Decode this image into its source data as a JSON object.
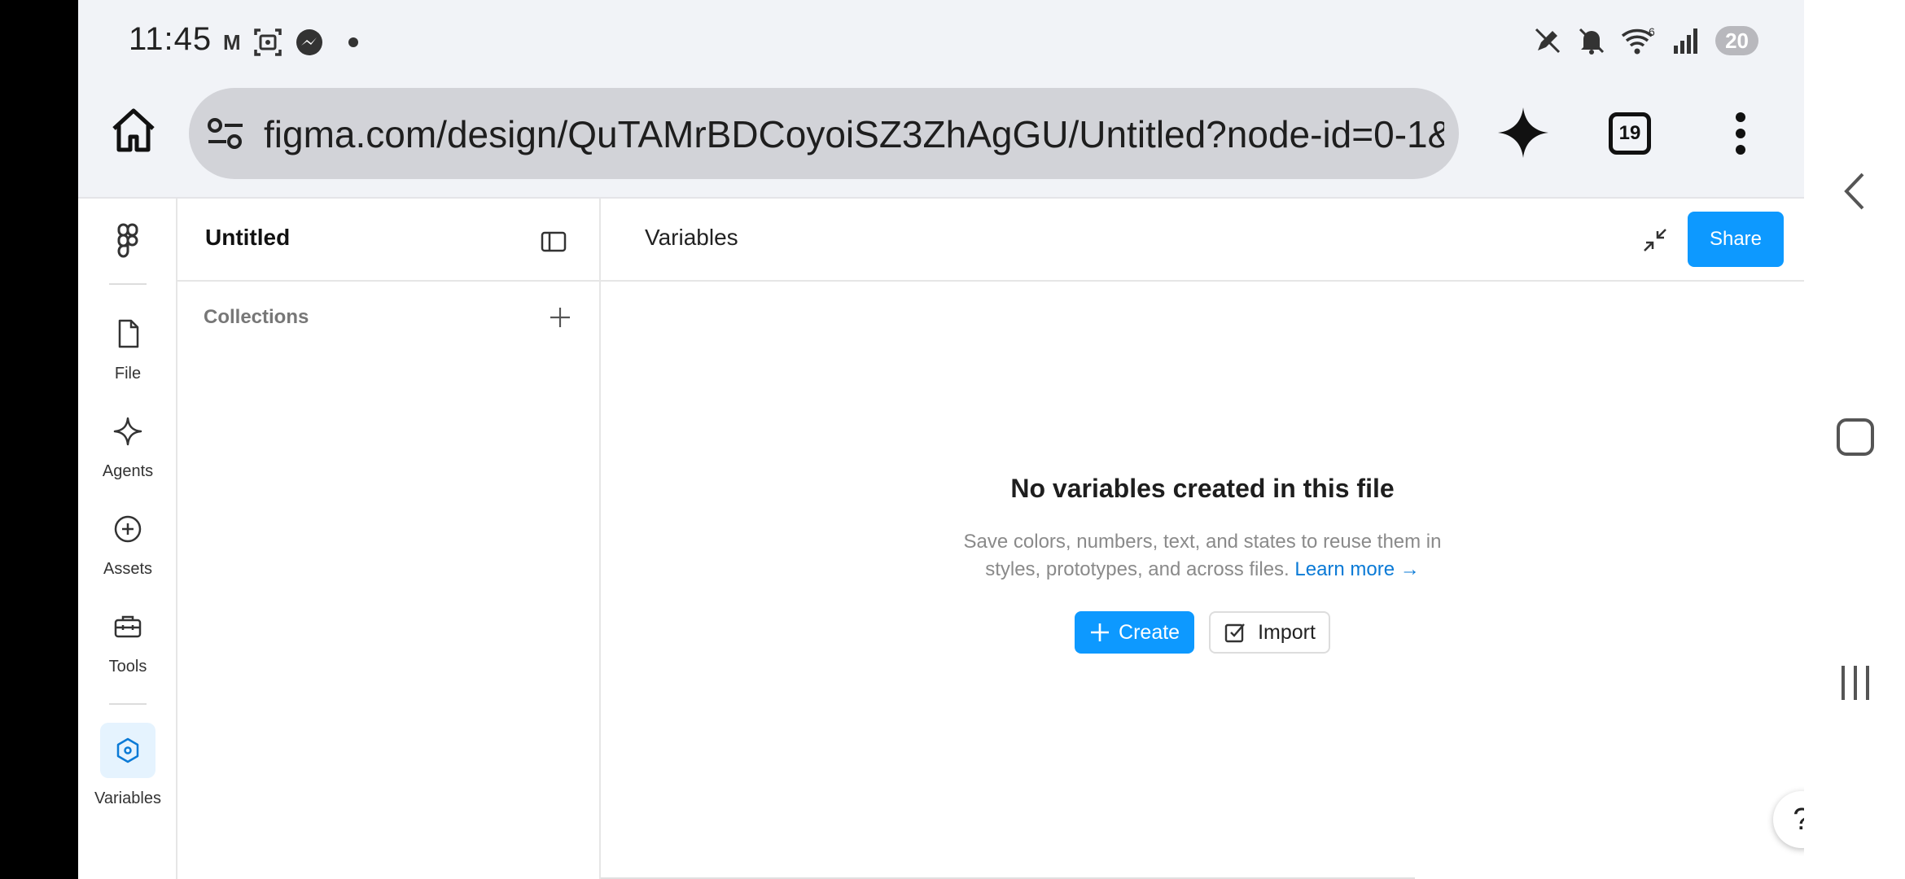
{
  "status_bar": {
    "time": "11:45",
    "notification_letter": "M",
    "battery": "20",
    "wifi_badge": "6"
  },
  "browser": {
    "url": "figma.com/design/QuTAMrBDCoyoiSZ3ZhAgGU/Untitled?node-id=0-1&",
    "tab_count": "19"
  },
  "rail": {
    "items": [
      {
        "label": "File",
        "icon": "file-icon"
      },
      {
        "label": "Agents",
        "icon": "sparkle-icon"
      },
      {
        "label": "Assets",
        "icon": "plus-circle-icon"
      },
      {
        "label": "Tools",
        "icon": "toolbox-icon"
      },
      {
        "label": "Variables",
        "icon": "hexagon-icon"
      }
    ]
  },
  "panel": {
    "title": "Untitled",
    "collections_label": "Collections"
  },
  "main": {
    "title": "Variables",
    "share_label": "Share",
    "empty_title": "No variables created in this file",
    "empty_desc": "Save colors, numbers, text, and states to reuse them in styles, prototypes, and across files.",
    "learn_more": "Learn more →",
    "create_label": "Create",
    "import_label": "Import",
    "help_label": "?"
  },
  "colors": {
    "accent": "#0d99ff",
    "link": "#0a7ad6",
    "active_rail_bg": "#e5f3fe"
  }
}
